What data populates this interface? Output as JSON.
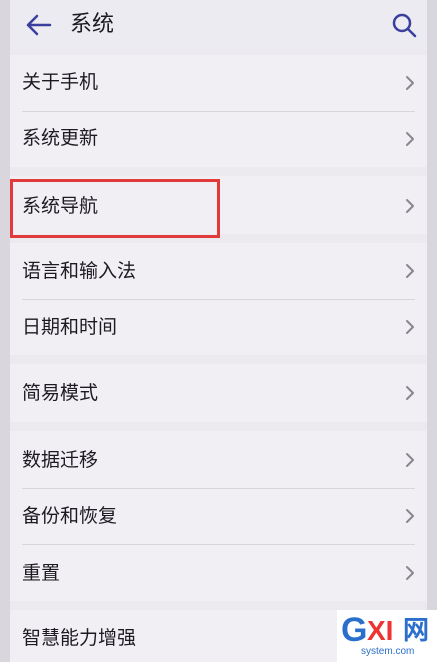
{
  "header": {
    "title": "系统",
    "back_icon": "back-arrow-icon",
    "search_icon": "search-icon"
  },
  "items": [
    {
      "label": "关于手机"
    },
    {
      "label": "系统更新"
    },
    {
      "label": "系统导航"
    },
    {
      "label": "语言和输入法"
    },
    {
      "label": "日期和时间"
    },
    {
      "label": "简易模式"
    },
    {
      "label": "数据迁移"
    },
    {
      "label": "备份和恢复"
    },
    {
      "label": "重置"
    },
    {
      "label": "智慧能力增强"
    }
  ],
  "colors": {
    "accent": "#3a3f9e",
    "highlight": "#e13a3a"
  },
  "watermark": {
    "brand": "GXI网",
    "brand_g": "G",
    "brand_xi": "XI",
    "brand_wang": "网",
    "domain": "system.com"
  }
}
